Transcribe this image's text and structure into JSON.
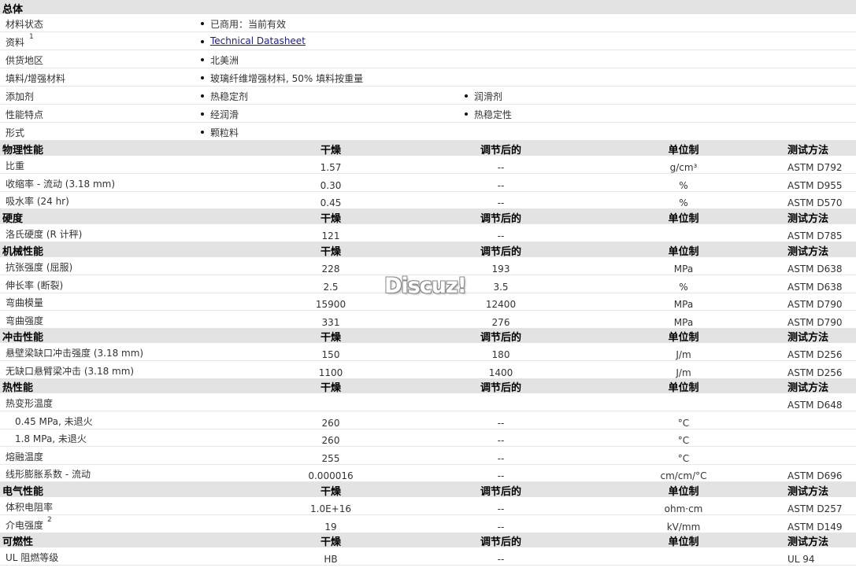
{
  "general": {
    "title": "总体",
    "rows": [
      {
        "label": "材料状态",
        "sup": "",
        "values": [
          "已商用：当前有效"
        ],
        "link": false
      },
      {
        "label": "资料",
        "sup": "1",
        "values": [
          "Technical Datasheet"
        ],
        "link": true
      },
      {
        "label": "供货地区",
        "sup": "",
        "values": [
          "北美洲"
        ],
        "link": false
      },
      {
        "label": "填料/增强材料",
        "sup": "",
        "values": [
          "玻璃纤维增强材料, 50% 填料按重量"
        ],
        "link": false
      },
      {
        "label": "添加剂",
        "sup": "",
        "values": [
          "热稳定剂",
          "润滑剂"
        ],
        "link": false
      },
      {
        "label": "性能特点",
        "sup": "",
        "values": [
          "经润滑",
          "热稳定性"
        ],
        "link": false
      },
      {
        "label": "形式",
        "sup": "",
        "values": [
          "颗粒料"
        ],
        "link": false
      }
    ]
  },
  "columns": {
    "dry": "干燥",
    "conditioned": "调节后的",
    "unit": "单位制",
    "method": "测试方法"
  },
  "sections": [
    {
      "title": "物理性能",
      "rows": [
        {
          "label": "比重",
          "sup": "",
          "indent": false,
          "dry": "1.57",
          "cond": "--",
          "unit": "g/cm³",
          "method": "ASTM D792"
        },
        {
          "label": "收缩率 - 流动 (3.18 mm)",
          "sup": "",
          "indent": false,
          "dry": "0.30",
          "cond": "--",
          "unit": "%",
          "method": "ASTM D955"
        },
        {
          "label": "吸水率 (24 hr)",
          "sup": "",
          "indent": false,
          "dry": "0.45",
          "cond": "--",
          "unit": "%",
          "method": "ASTM D570"
        }
      ]
    },
    {
      "title": "硬度",
      "rows": [
        {
          "label": "洛氏硬度 (R 计秤)",
          "sup": "",
          "indent": false,
          "dry": "121",
          "cond": "--",
          "unit": "",
          "method": "ASTM D785"
        }
      ]
    },
    {
      "title": "机械性能",
      "rows": [
        {
          "label": "抗张强度 (屈服)",
          "sup": "",
          "indent": false,
          "dry": "228",
          "cond": "193",
          "unit": "MPa",
          "method": "ASTM D638"
        },
        {
          "label": "伸长率 (断裂)",
          "sup": "",
          "indent": false,
          "dry": "2.5",
          "cond": "3.5",
          "unit": "%",
          "method": "ASTM D638"
        },
        {
          "label": "弯曲模量",
          "sup": "",
          "indent": false,
          "dry": "15900",
          "cond": "12400",
          "unit": "MPa",
          "method": "ASTM D790"
        },
        {
          "label": "弯曲强度",
          "sup": "",
          "indent": false,
          "dry": "331",
          "cond": "276",
          "unit": "MPa",
          "method": "ASTM D790"
        }
      ]
    },
    {
      "title": "冲击性能",
      "rows": [
        {
          "label": "悬壁梁缺口冲击强度 (3.18 mm)",
          "sup": "",
          "indent": false,
          "dry": "150",
          "cond": "180",
          "unit": "J/m",
          "method": "ASTM D256"
        },
        {
          "label": "无缺口悬臂梁冲击 (3.18 mm)",
          "sup": "",
          "indent": false,
          "dry": "1100",
          "cond": "1400",
          "unit": "J/m",
          "method": "ASTM D256"
        }
      ]
    },
    {
      "title": "热性能",
      "rows": [
        {
          "label": "热变形温度",
          "sup": "",
          "indent": false,
          "dry": "",
          "cond": "",
          "unit": "",
          "method": "ASTM D648"
        },
        {
          "label": "0.45 MPa, 未退火",
          "sup": "",
          "indent": true,
          "dry": "260",
          "cond": "--",
          "unit": "°C",
          "method": ""
        },
        {
          "label": "1.8 MPa, 未退火",
          "sup": "",
          "indent": true,
          "dry": "260",
          "cond": "--",
          "unit": "°C",
          "method": ""
        },
        {
          "label": "熔融温度",
          "sup": "",
          "indent": false,
          "dry": "255",
          "cond": "--",
          "unit": "°C",
          "method": ""
        },
        {
          "label": "线形膨胀系数 - 流动",
          "sup": "",
          "indent": false,
          "dry": "0.000016",
          "cond": "--",
          "unit": "cm/cm/°C",
          "method": "ASTM D696"
        }
      ]
    },
    {
      "title": "电气性能",
      "rows": [
        {
          "label": "体积电阻率",
          "sup": "",
          "indent": false,
          "dry": "1.0E+16",
          "cond": "--",
          "unit": "ohm·cm",
          "method": "ASTM D257"
        },
        {
          "label": "介电强度",
          "sup": "2",
          "indent": false,
          "dry": "19",
          "cond": "--",
          "unit": "kV/mm",
          "method": "ASTM D149"
        }
      ]
    },
    {
      "title": "可燃性",
      "rows": [
        {
          "label": "UL 阻燃等级",
          "sup": "",
          "indent": false,
          "dry": "HB",
          "cond": "--",
          "unit": "",
          "method": "UL 94"
        }
      ]
    }
  ],
  "watermark": "Discuz!"
}
